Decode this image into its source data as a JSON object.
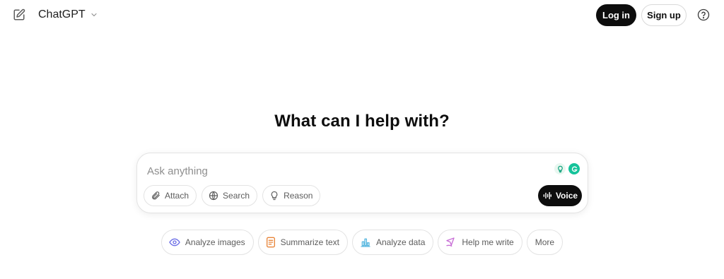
{
  "header": {
    "model_name": "ChatGPT",
    "login_label": "Log in",
    "signup_label": "Sign up"
  },
  "hero": {
    "title": "What can I help with?"
  },
  "composer": {
    "placeholder": "Ask anything",
    "tools": [
      {
        "label": "Attach",
        "icon": "paperclip-icon"
      },
      {
        "label": "Search",
        "icon": "globe-icon"
      },
      {
        "label": "Reason",
        "icon": "lightbulb-icon"
      }
    ],
    "voice_label": "Voice"
  },
  "suggestions": [
    {
      "label": "Analyze images",
      "icon": "eye-icon",
      "color": "#6b6ee6"
    },
    {
      "label": "Summarize text",
      "icon": "document-icon",
      "color": "#e8853a"
    },
    {
      "label": "Analyze data",
      "icon": "bar-chart-icon",
      "color": "#5ab8e0"
    },
    {
      "label": "Help me write",
      "icon": "pen-icon",
      "color": "#c86fd6"
    },
    {
      "label": "More"
    }
  ],
  "colors": {
    "primary": "#0d0d0d",
    "border": "#e3e3e3",
    "muted_text": "#5d5d5d",
    "grammarly": "#15c39a"
  }
}
